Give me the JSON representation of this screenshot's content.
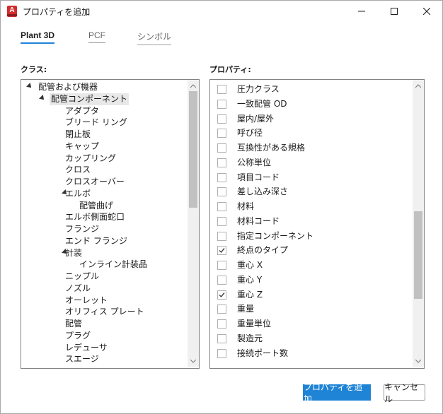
{
  "window": {
    "title": "プロパティを追加",
    "icon_letter": "A"
  },
  "tabs": [
    {
      "label": "Plant 3D",
      "active": true
    },
    {
      "label": "PCF",
      "active": false
    },
    {
      "label": "シンボル",
      "active": false
    }
  ],
  "class_panel": {
    "label": "クラス:",
    "tree": [
      {
        "label": "配管および機器",
        "level": 0,
        "expanded": true
      },
      {
        "label": "配管コンポーネント",
        "level": 1,
        "expanded": true,
        "selected": true
      },
      {
        "label": "アダプタ",
        "level": 2
      },
      {
        "label": "ブリード リング",
        "level": 2
      },
      {
        "label": "閉止板",
        "level": 2
      },
      {
        "label": "キャップ",
        "level": 2
      },
      {
        "label": "カップリング",
        "level": 2
      },
      {
        "label": "クロス",
        "level": 2
      },
      {
        "label": "クロスオーバー",
        "level": 2
      },
      {
        "label": "エルボ",
        "level": 2,
        "expanded": true
      },
      {
        "label": "配管曲げ",
        "level": 3
      },
      {
        "label": "エルボ側面蛇口",
        "level": 2
      },
      {
        "label": "フランジ",
        "level": 2
      },
      {
        "label": "エンド フランジ",
        "level": 2
      },
      {
        "label": "計装",
        "level": 2,
        "expanded": true
      },
      {
        "label": "インライン計装品",
        "level": 3
      },
      {
        "label": "ニップル",
        "level": 2
      },
      {
        "label": "ノズル",
        "level": 2
      },
      {
        "label": "オーレット",
        "level": 2
      },
      {
        "label": "オリフィス プレート",
        "level": 2
      },
      {
        "label": "配管",
        "level": 2
      },
      {
        "label": "プラグ",
        "level": 2
      },
      {
        "label": "レデューサ",
        "level": 2
      },
      {
        "label": "スエージ",
        "level": 2
      }
    ]
  },
  "property_panel": {
    "label": "プロパティ:",
    "items": [
      {
        "label": "圧力クラス",
        "checked": false
      },
      {
        "label": "一致配管 OD",
        "checked": false
      },
      {
        "label": "屋内/屋外",
        "checked": false
      },
      {
        "label": "呼び径",
        "checked": false
      },
      {
        "label": "互換性がある規格",
        "checked": false
      },
      {
        "label": "公称単位",
        "checked": false
      },
      {
        "label": "項目コード",
        "checked": false
      },
      {
        "label": "差し込み深さ",
        "checked": false
      },
      {
        "label": "材料",
        "checked": false
      },
      {
        "label": "材料コード",
        "checked": false
      },
      {
        "label": "指定コンポーネント",
        "checked": false
      },
      {
        "label": "終点のタイプ",
        "checked": true
      },
      {
        "label": "重心 X",
        "checked": false
      },
      {
        "label": "重心 Y",
        "checked": false
      },
      {
        "label": "重心 Z",
        "checked": true
      },
      {
        "label": "重量",
        "checked": false
      },
      {
        "label": "重量単位",
        "checked": false
      },
      {
        "label": "製造元",
        "checked": false
      },
      {
        "label": "接続ポート数",
        "checked": false
      }
    ]
  },
  "buttons": {
    "add": "プロパティを追加",
    "cancel": "キャンセル"
  },
  "colors": {
    "accent": "#1f83d6",
    "brand_icon": "#d12d2d"
  }
}
